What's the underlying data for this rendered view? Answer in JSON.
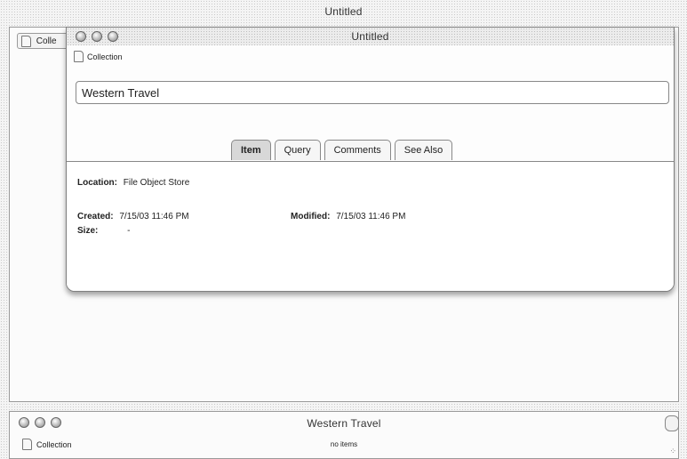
{
  "app": {
    "title": "Untitled"
  },
  "back_window": {
    "tab_label": "Colle"
  },
  "inspector": {
    "title": "Untitled",
    "kind_label": "Collection",
    "name_value": "Western Travel",
    "tabs": [
      {
        "label": "Item",
        "active": true
      },
      {
        "label": "Query",
        "active": false
      },
      {
        "label": "Comments",
        "active": false
      },
      {
        "label": "See Also",
        "active": false
      }
    ],
    "location_label": "Location:",
    "location_value": "File Object Store",
    "created_label": "Created:",
    "created_value": "7/15/03 11:46 PM",
    "modified_label": "Modified:",
    "modified_value": "7/15/03 11:46 PM",
    "size_label": "Size:",
    "size_value": "-"
  },
  "bottom_window": {
    "title": "Western Travel",
    "kind_label": "Collection",
    "item_count": "no items"
  }
}
